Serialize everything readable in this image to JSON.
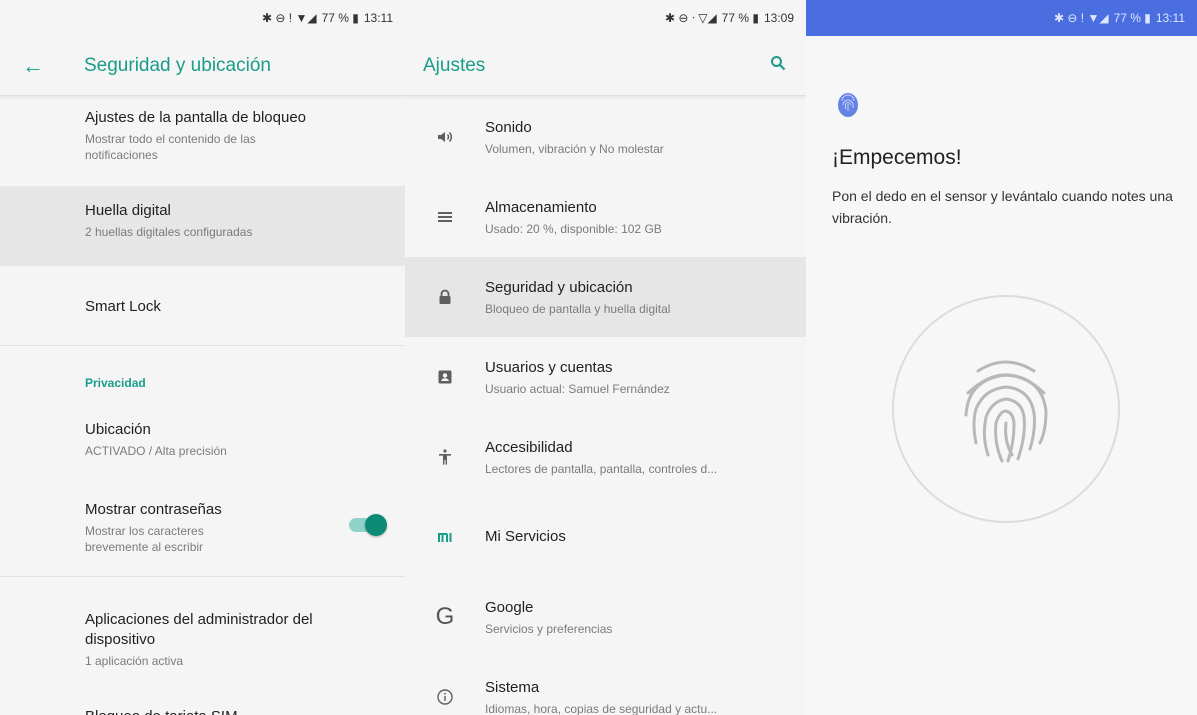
{
  "status_bars": [
    {
      "icons": "✱ ⊖ ! ▼◢",
      "battery": "77 % ▮",
      "time": "13:11"
    },
    {
      "icons": "✱ ⊖ ᐧ ▽◢",
      "battery": "77 % ▮",
      "time": "13:09"
    },
    {
      "icons": "✱ ⊖ ! ▼◢",
      "battery": "77 % ▮",
      "time": "13:11"
    }
  ],
  "security_panel": {
    "title": "Seguridad y ubicación",
    "back_icon": "arrow-left-icon",
    "items": [
      {
        "title": "Ajustes de la pantalla de bloqueo",
        "subtitle": "Mostrar todo el contenido de las notificaciones"
      },
      {
        "title": "Huella digital",
        "subtitle": "2 huellas digitales configuradas"
      },
      {
        "title": "Smart Lock"
      }
    ],
    "section_privacy": "Privacidad",
    "privacy_items": [
      {
        "title": "Ubicación",
        "subtitle": "ACTIVADO / Alta precisión"
      },
      {
        "title": "Mostrar contraseñas",
        "subtitle": "Mostrar los caracteres brevemente al escribir",
        "toggle_on": true
      }
    ],
    "admin_item": {
      "title": "Aplicaciones del administrador del dispositivo",
      "subtitle": "1 aplicación activa"
    },
    "cut_item": {
      "title": "Bloqueo de tarjeta SIM"
    }
  },
  "settings_panel": {
    "title": "Ajustes",
    "search_icon": "search-icon",
    "rows": [
      {
        "icon": "volume-icon",
        "title": "Sonido",
        "subtitle": "Volumen, vibración y No molestar"
      },
      {
        "icon": "storage-icon",
        "title": "Almacenamiento",
        "subtitle": "Usado: 20 %, disponible: 102 GB"
      },
      {
        "icon": "lock-icon",
        "title": "Seguridad y ubicación",
        "subtitle": "Bloqueo de pantalla y huella digital"
      },
      {
        "icon": "account-box-icon",
        "title": "Usuarios y cuentas",
        "subtitle": "Usuario actual: Samuel Fernández"
      },
      {
        "icon": "accessibility-icon",
        "title": "Accesibilidad",
        "subtitle": "Lectores de pantalla, pantalla, controles d..."
      },
      {
        "icon": "mi-logo-icon",
        "title": "Mi Servicios",
        "subtitle": ""
      },
      {
        "icon": "google-icon",
        "title": "Google",
        "subtitle": "Servicios y preferencias"
      },
      {
        "icon": "info-icon",
        "title": "Sistema",
        "subtitle": "Idiomas, hora, copias de seguridad y actu..."
      }
    ]
  },
  "fingerprint_panel": {
    "small_icon": "fingerprint-icon",
    "heading": "¡Empecemos!",
    "body": "Pon el dedo en el sensor y levántalo cuando notes una vibración.",
    "sensor_icon": "fingerprint-sensor-icon"
  },
  "colors": {
    "accent": "#1a9c8a",
    "highlight": "#e6e6e6",
    "status_bar_blue": "#4a6ee0"
  }
}
